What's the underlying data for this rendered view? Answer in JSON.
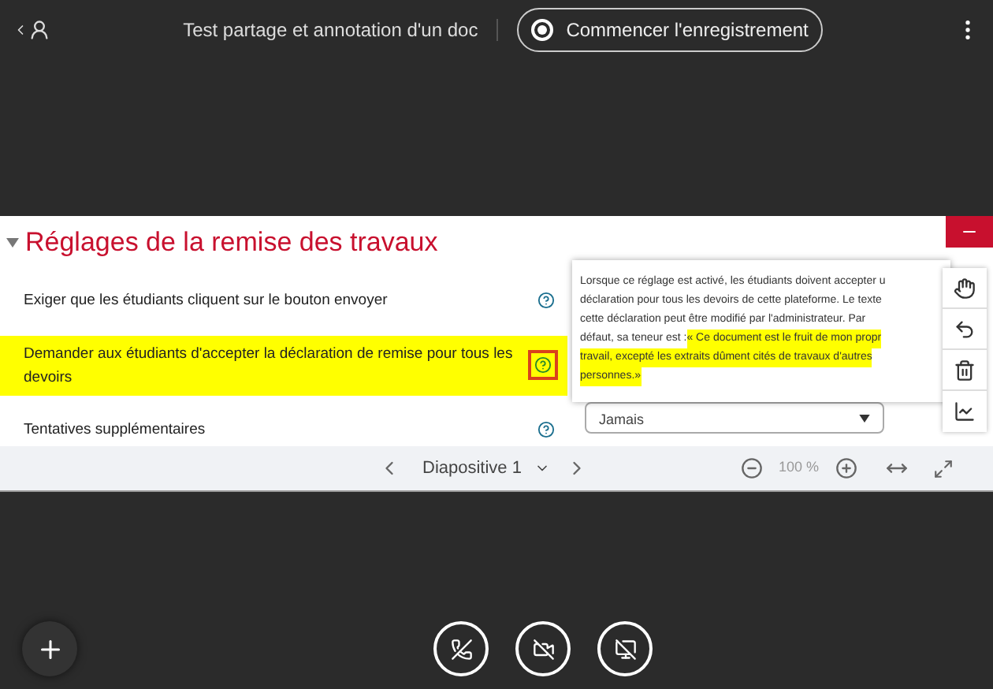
{
  "top_bar": {
    "title": "Test partage et annotation d'un doc",
    "record_button": "Commencer l'enregistrement"
  },
  "slide": {
    "heading": "Réglages de la remise des travaux",
    "expanded": true,
    "rows": [
      {
        "label": "Exiger que les étudiants cliquent sur le bouton envoyer",
        "highlighted": false
      },
      {
        "label": "Demander aux étudiants d'accepter la déclaration de remise pour tous les devoirs",
        "highlighted": true
      },
      {
        "label": "Tentatives supplémentaires",
        "highlighted": false
      }
    ],
    "select_value": "Jamais",
    "popover_lines": [
      [
        {
          "text": "Lorsque ce réglage est activé, les étudiants doivent accepter u",
          "highlighted": false
        }
      ],
      [
        {
          "text": "déclaration pour tous les devoirs de cette plateforme. Le texte",
          "highlighted": false
        }
      ],
      [
        {
          "text": "cette déclaration peut être modifié par l'administrateur. Par",
          "highlighted": false
        }
      ],
      [
        {
          "text": "défaut, sa teneur est : ",
          "highlighted": false
        },
        {
          "text": "« Ce document est le fruit de mon propr",
          "highlighted": true
        }
      ],
      [
        {
          "text": "travail, excepté les extraits dûment cités de travaux d'autres",
          "highlighted": true
        }
      ],
      [
        {
          "text": "personnes.»",
          "highlighted": true
        }
      ]
    ]
  },
  "slide_nav": {
    "slide_label": "Diapositive 1",
    "zoom": "100 %"
  }
}
